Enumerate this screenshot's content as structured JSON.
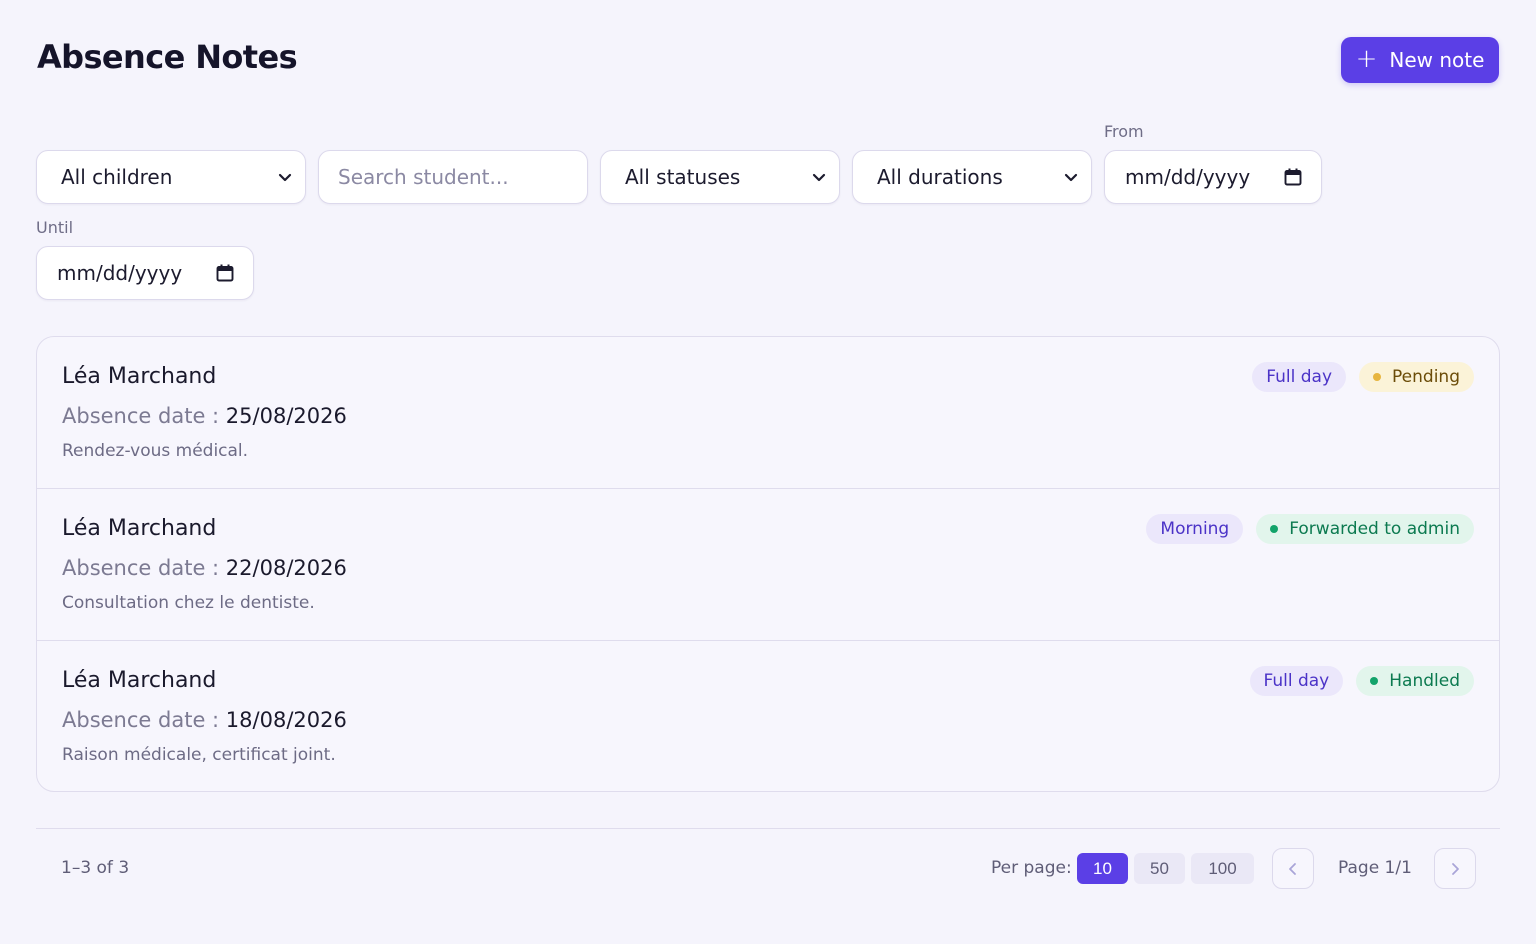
{
  "header": {
    "title": "Absence Notes",
    "new_button_label": "New note"
  },
  "filters": {
    "children_select": "All children",
    "search_placeholder": "Search student...",
    "status_select": "All statuses",
    "duration_select": "All durations",
    "from_label": "From",
    "from_placeholder": "mm/dd/yyyy",
    "until_label": "Until",
    "until_placeholder": "mm/dd/yyyy"
  },
  "notes": [
    {
      "student": "Léa Marchand",
      "date_label": "Absence date : ",
      "date": "25/08/2026",
      "reason": "Rendez-vous médical.",
      "duration": "Full day",
      "status": "Pending",
      "status_color": "#e7b53e",
      "status_text_color": "#6b4c08",
      "status_bg": "#fbf3d8"
    },
    {
      "student": "Léa Marchand",
      "date_label": "Absence date : ",
      "date": "22/08/2026",
      "reason": "Consultation chez le dentiste.",
      "duration": "Morning",
      "status": "Forwarded to admin",
      "status_color": "#12a36a",
      "status_text_color": "#0c7a50",
      "status_bg": "#e2f5ec"
    },
    {
      "student": "Léa Marchand",
      "date_label": "Absence date : ",
      "date": "18/08/2026",
      "reason": "Raison médicale, certificat joint.",
      "duration": "Full day",
      "status": "Handled",
      "status_color": "#12a36a",
      "status_text_color": "#0c7a50",
      "status_bg": "#e2f5ec"
    }
  ],
  "footer": {
    "count": "1–3 of 3",
    "per_page_label": "Per page:",
    "per_page_options": [
      "10",
      "50",
      "100"
    ],
    "per_page_selected": "10",
    "page_info": "Page 1/1"
  },
  "colors": {
    "accent": "#5b3fe6",
    "background": "#f5f4fc"
  }
}
